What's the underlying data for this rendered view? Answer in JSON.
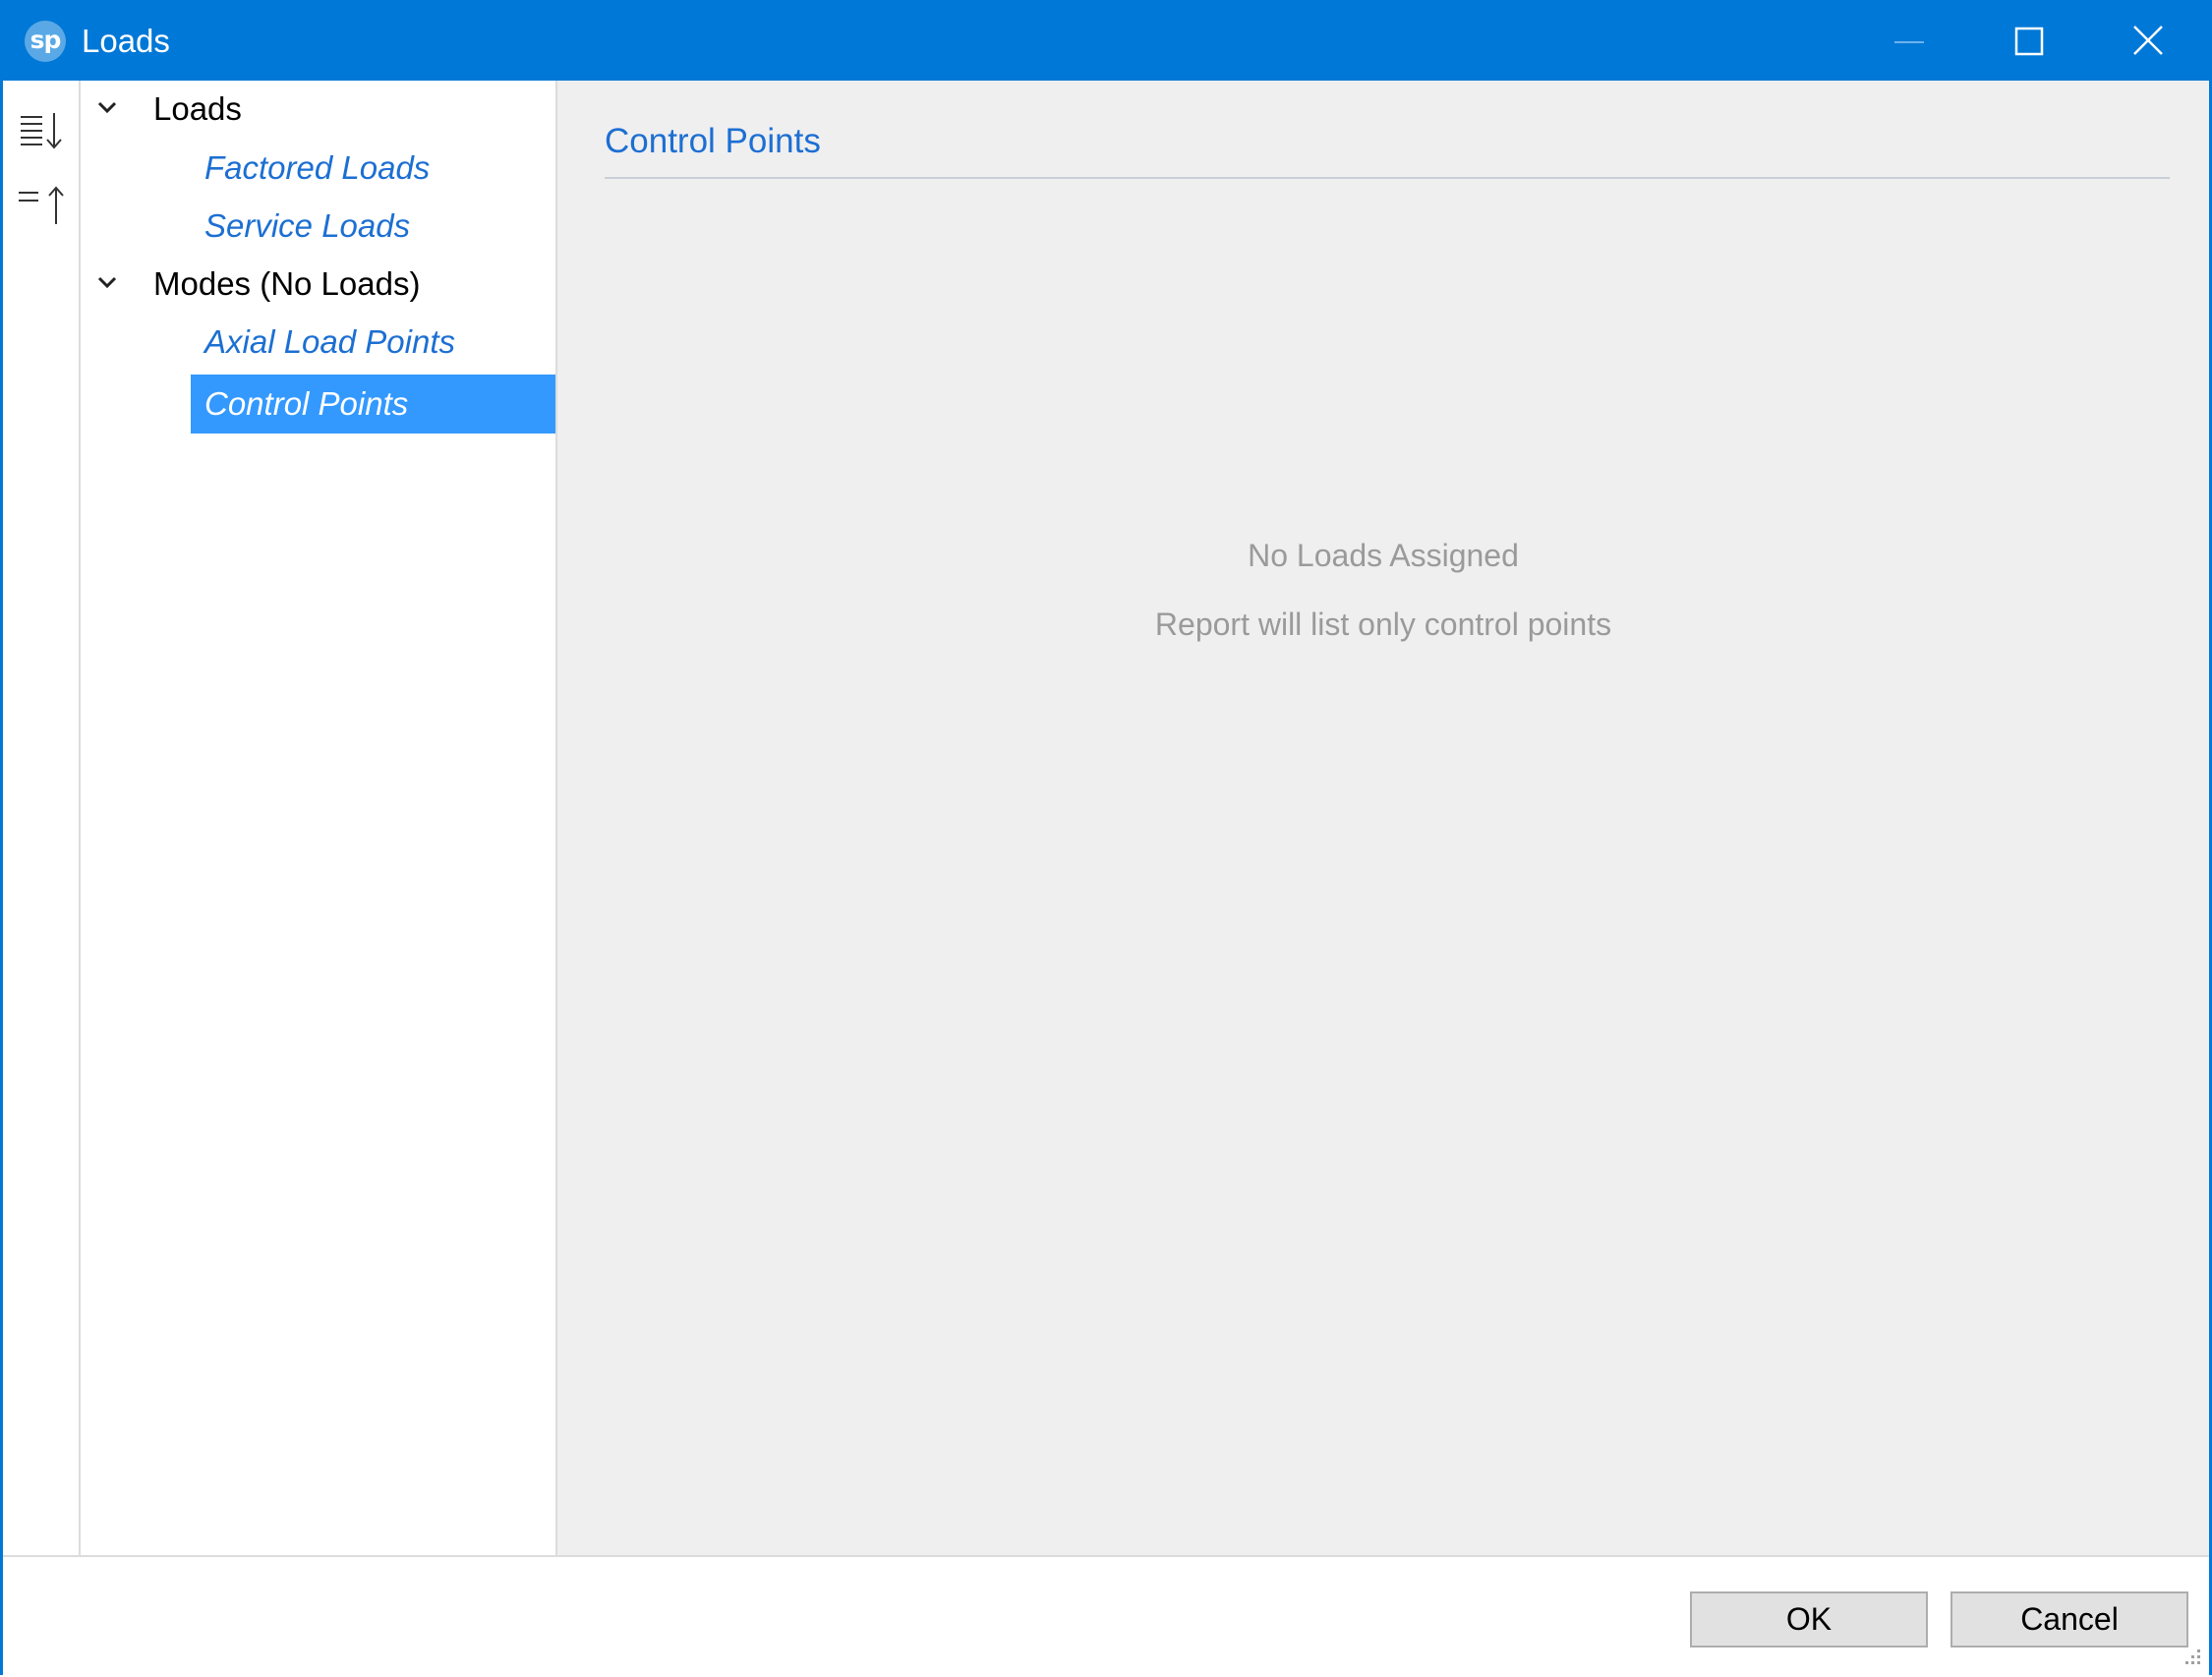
{
  "window": {
    "title": "Loads",
    "app_icon_text": "sp",
    "accent_color": "#0078d7"
  },
  "toolbar": {
    "expand_all_icon": "expand-all-icon",
    "collapse_all_icon": "collapse-all-icon"
  },
  "tree": {
    "groups": [
      {
        "label": "Loads",
        "expanded": true,
        "items": [
          {
            "label": "Factored Loads",
            "selected": false
          },
          {
            "label": "Service Loads",
            "selected": false
          }
        ]
      },
      {
        "label": "Modes (No Loads)",
        "expanded": true,
        "items": [
          {
            "label": "Axial Load Points",
            "selected": false
          },
          {
            "label": "Control Points",
            "selected": true
          }
        ]
      }
    ]
  },
  "content": {
    "title": "Control Points",
    "empty_message": "No Loads Assigned",
    "empty_detail": "Report will list only control points"
  },
  "footer": {
    "ok_label": "OK",
    "cancel_label": "Cancel"
  }
}
